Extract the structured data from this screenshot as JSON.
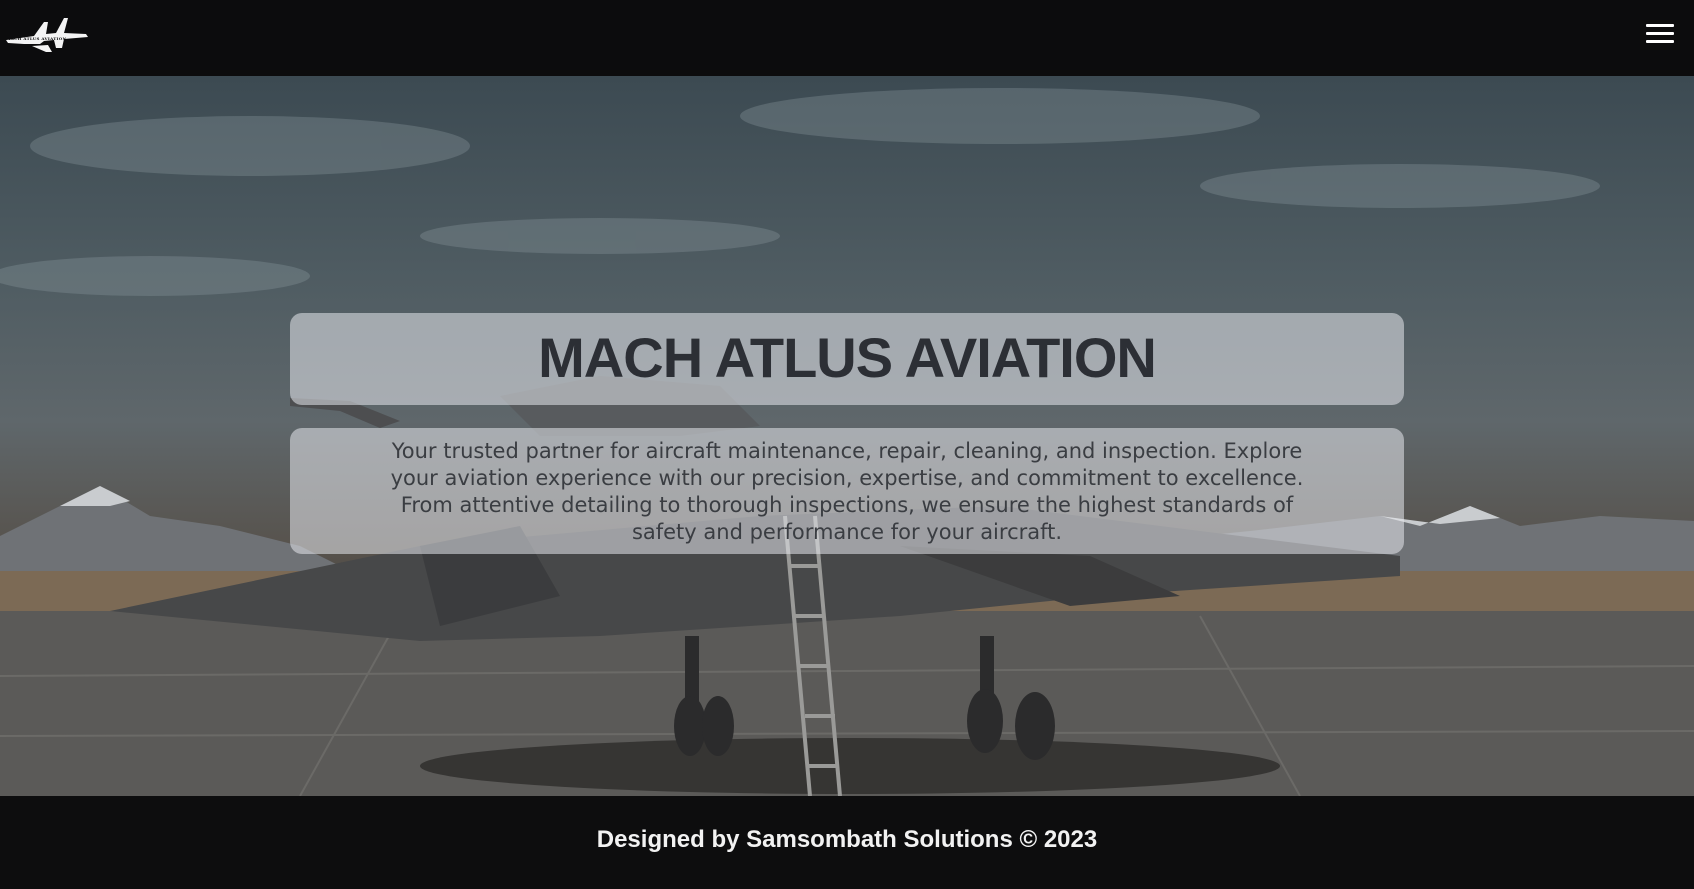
{
  "header": {
    "logo_text": "MACH ATLUS AVIATION",
    "menu_icon": "hamburger-menu-icon"
  },
  "hero": {
    "title": "MACH ATLUS AVIATION",
    "description": "Your trusted partner for aircraft maintenance, repair, cleaning, and inspection. Explore your aviation experience with our precision, expertise, and commitment to excellence. From attentive detailing to thorough inspections, we ensure the highest standards of safety and performance for your aircraft."
  },
  "footer": {
    "credit": "Designed by Samsombath Solutions © 2023"
  },
  "colors": {
    "header_bg": "#0c0c0d",
    "footer_bg": "#0d0d0e",
    "panel_bg": "rgba(230,232,236,0.55)",
    "title_color": "#2c2f35"
  }
}
